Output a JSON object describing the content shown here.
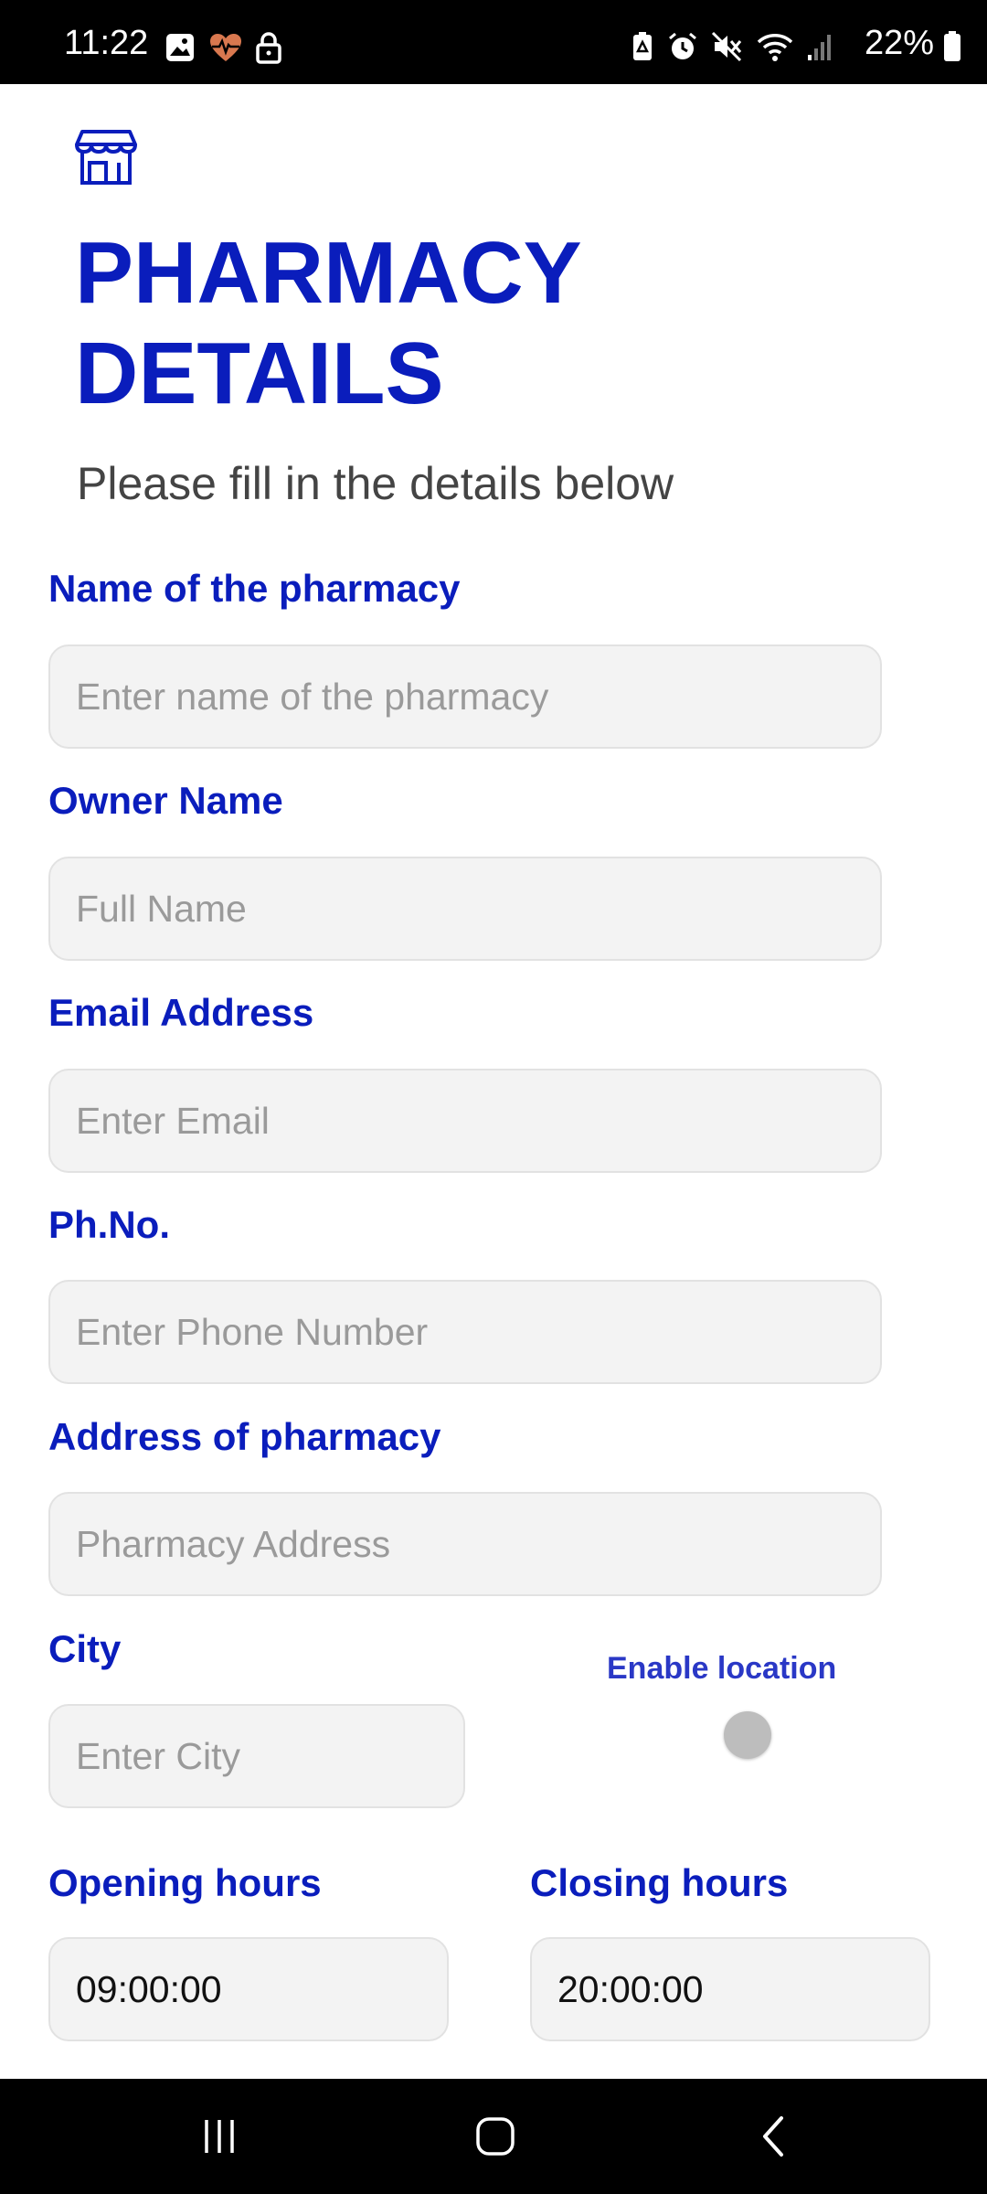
{
  "status_bar": {
    "time": "11:22",
    "battery": "22%",
    "left_icons": [
      "image-icon",
      "heart-pulse-icon",
      "lock-icon"
    ],
    "right_icons": [
      "battery-saver-icon",
      "alarm-icon",
      "mute-icon",
      "wifi-icon",
      "signal-icon"
    ]
  },
  "header": {
    "icon": "store-icon",
    "title": "PHARMACY DETAILS",
    "subtitle": "Please fill in the details below"
  },
  "form": {
    "pharmacy_name": {
      "label": "Name of the pharmacy",
      "placeholder": "Enter name of the pharmacy",
      "value": ""
    },
    "owner_name": {
      "label": "Owner Name",
      "placeholder": "Full Name",
      "value": ""
    },
    "email": {
      "label": "Email Address",
      "placeholder": "Enter Email",
      "value": ""
    },
    "phone": {
      "label": "Ph.No.",
      "placeholder": "Enter Phone Number",
      "value": ""
    },
    "address": {
      "label": "Address of pharmacy",
      "placeholder": "Pharmacy Address",
      "value": ""
    },
    "city": {
      "label": "City",
      "placeholder": "Enter City",
      "value": ""
    },
    "enable_location": {
      "label": "Enable location",
      "enabled": false
    },
    "opening_hours": {
      "label": "Opening hours",
      "value": "09:00:00"
    },
    "closing_hours": {
      "label": "Closing hours",
      "value": "20:00:00"
    }
  },
  "nav_bar": {
    "buttons": [
      "recent-apps-icon",
      "home-icon",
      "back-icon"
    ]
  },
  "colors": {
    "accent": "#0a1dbc",
    "input_bg": "#f3f3f3",
    "placeholder": "#9a9a9a"
  }
}
